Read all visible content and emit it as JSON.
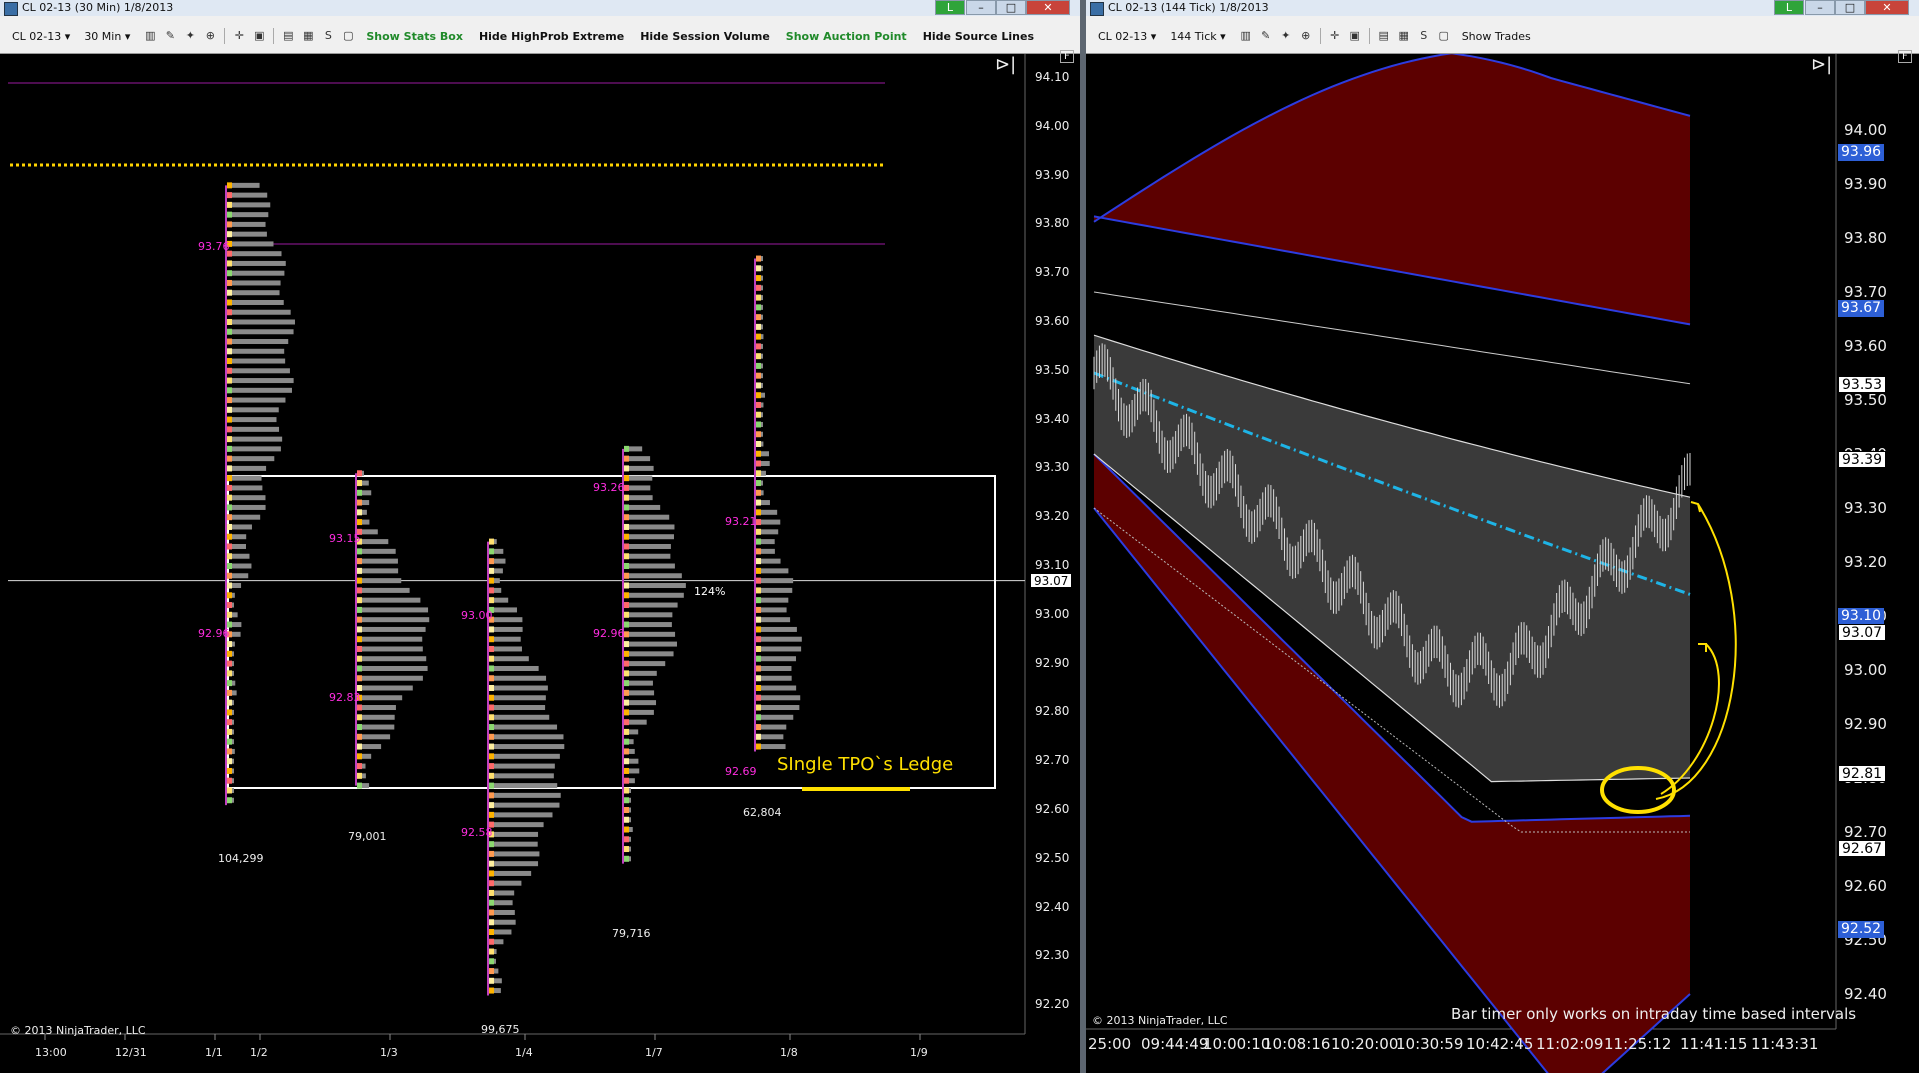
{
  "left": {
    "title": "CL 02-13 (30 Min)  1/8/2013",
    "toolbar": {
      "instrument": "CL 02-13",
      "interval": "30 Min",
      "buttons": [
        "Show Stats Box",
        "Hide HighProb Extreme",
        "Hide Session Volume",
        "Show Auction Point",
        "Hide Source Lines"
      ]
    },
    "y_labels": [
      "94.10",
      "94.00",
      "93.90",
      "93.80",
      "93.70",
      "93.60",
      "93.50",
      "93.40",
      "93.30",
      "93.20",
      "93.10",
      "93.00",
      "92.90",
      "92.80",
      "92.70",
      "92.60",
      "92.50",
      "92.40",
      "92.30",
      "92.20"
    ],
    "y_current": "93.07",
    "x_labels": [
      "13:00",
      "12/31",
      "1/1",
      "1/2",
      "1/3",
      "1/4",
      "1/7",
      "1/8",
      "1/9"
    ],
    "profile_tags": [
      "93.76",
      "92.96",
      "93.15",
      "92.83",
      "93.00",
      "92.58",
      "93.26",
      "92.96",
      "93.21",
      "92.69"
    ],
    "volumes": [
      "104,299",
      "79,001",
      "99,675",
      "79,716",
      "62,804"
    ],
    "pct_label": "124%",
    "annotation": "SIngle TPO`s Ledge",
    "copyright": "© 2013 NinjaTrader, LLC"
  },
  "right": {
    "title": "CL 02-13 (144 Tick)  1/8/2013",
    "toolbar": {
      "instrument": "CL 02-13",
      "interval": "144 Tick",
      "buttons": [
        "Show Trades"
      ]
    },
    "y_labels": [
      "94.00",
      "93.90",
      "93.80",
      "93.70",
      "93.60",
      "93.50",
      "93.40",
      "93.30",
      "93.20",
      "93.10",
      "93.00",
      "92.90",
      "92.80",
      "92.70",
      "92.60",
      "92.50",
      "92.40"
    ],
    "price_tags": [
      {
        "value": "93.96",
        "style": "blue"
      },
      {
        "value": "93.67",
        "style": "blue"
      },
      {
        "value": "93.53",
        "style": "white"
      },
      {
        "value": "93.39",
        "style": "white"
      },
      {
        "value": "93.10",
        "style": "blue"
      },
      {
        "value": "93.07",
        "style": "white"
      },
      {
        "value": "92.81",
        "style": "white"
      },
      {
        "value": "92.67",
        "style": "white"
      },
      {
        "value": "92.52",
        "style": "blue"
      }
    ],
    "x_labels": [
      "25:00",
      "09:44:49",
      "10:00:10",
      "10:08:16",
      "10:20:00",
      "10:30:59",
      "10:42:45",
      "11:02:09",
      "11:25:12",
      "11:41:15",
      "11:43:31"
    ],
    "timer_msg": "Bar timer only works on intraday time based intervals",
    "copyright": "© 2013 NinjaTrader, LLC"
  }
}
